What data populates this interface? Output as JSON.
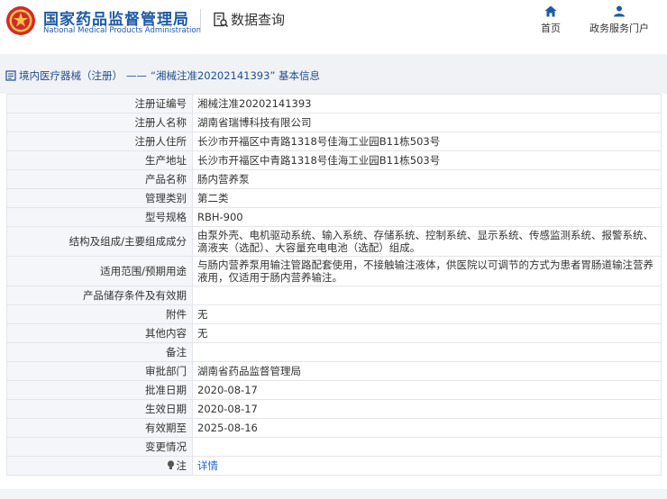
{
  "header": {
    "brand_cn": "国家药品监督管理局",
    "brand_en": "National Medical Products Administration",
    "data_query": "数据查询",
    "nav": {
      "home": "首页",
      "gov_portal": "政务服务门户"
    }
  },
  "breadcrumb": {
    "section": "境内医疗器械（注册）",
    "separator": "——",
    "title": "“湘械注准20202141393” 基本信息"
  },
  "record": [
    {
      "label": "注册证编号",
      "value": "湘械注准20202141393"
    },
    {
      "label": "注册人名称",
      "value": "湖南省瑞博科技有限公司"
    },
    {
      "label": "注册人住所",
      "value": "长沙市开福区中青路1318号佳海工业园B11栋503号"
    },
    {
      "label": "生产地址",
      "value": "长沙市开福区中青路1318号佳海工业园B11栋503号"
    },
    {
      "label": "产品名称",
      "value": "肠内营养泵"
    },
    {
      "label": "管理类别",
      "value": "第二类"
    },
    {
      "label": "型号规格",
      "value": "RBH-900"
    },
    {
      "label": "结构及组成/主要组成成分",
      "value": "由泵外壳、电机驱动系统、输入系统、存储系统、控制系统、显示系统、传感监测系统、报警系统、滴液夹（选配）、大容量充电电池（选配）组成。"
    },
    {
      "label": "适用范围/预期用途",
      "value": "与肠内营养泵用输注管路配套使用，不接触输注液体，供医院以可调节的方式为患者胃肠道输注营养液用，仅适用于肠内营养输注。"
    },
    {
      "label": "产品储存条件及有效期",
      "value": ""
    },
    {
      "label": "附件",
      "value": "无"
    },
    {
      "label": "其他内容",
      "value": "无"
    },
    {
      "label": "备注",
      "value": ""
    },
    {
      "label": "审批部门",
      "value": "湖南省药品监督管理局"
    },
    {
      "label": "批准日期",
      "value": "2020-08-17"
    },
    {
      "label": "生效日期",
      "value": "2020-08-17"
    },
    {
      "label": "有效期至",
      "value": "2025-08-16"
    },
    {
      "label": "变更情况",
      "value": ""
    }
  ],
  "note_row": {
    "label": "注",
    "link": "详情",
    "icon": "bulb-icon"
  },
  "colors": {
    "brand_blue": "#1f5aa6",
    "link_blue": "#1f66c2",
    "label_bg": "#f4f6f9",
    "band_bg": "#f0f2f5"
  }
}
